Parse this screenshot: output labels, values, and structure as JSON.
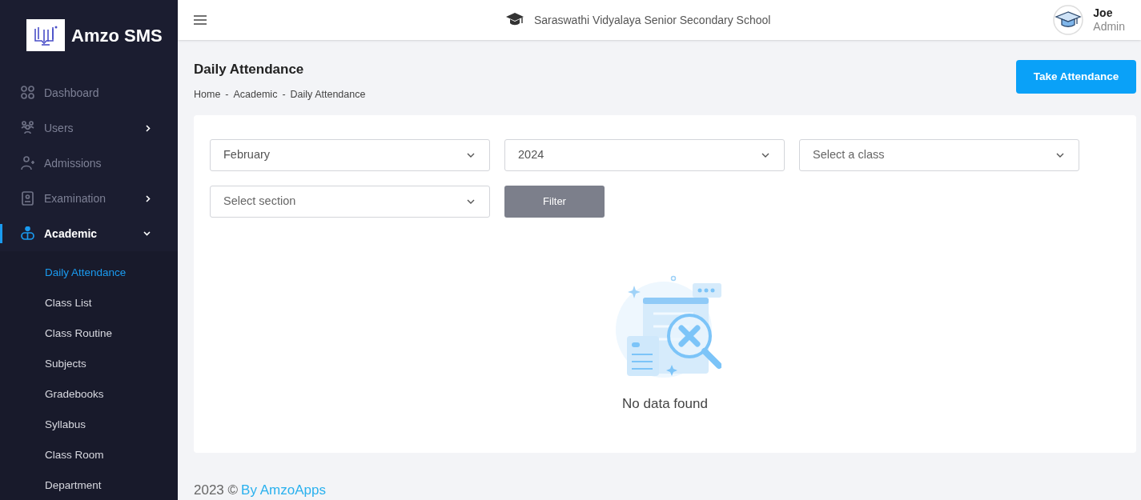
{
  "brand": {
    "name": "Amzo SMS"
  },
  "sidebar": {
    "items": [
      {
        "label": "Dashboard",
        "selected": false
      },
      {
        "label": "Users",
        "selected": false,
        "expanded": false
      },
      {
        "label": "Admissions",
        "selected": false
      },
      {
        "label": "Examination",
        "selected": false,
        "expanded": false
      },
      {
        "label": "Academic",
        "selected": true,
        "expanded": true,
        "children": [
          {
            "label": "Daily Attendance",
            "selected": true
          },
          {
            "label": "Class List",
            "selected": false
          },
          {
            "label": "Class Routine",
            "selected": false
          },
          {
            "label": "Subjects",
            "selected": false
          },
          {
            "label": "Gradebooks",
            "selected": false
          },
          {
            "label": "Syllabus",
            "selected": false
          },
          {
            "label": "Class Room",
            "selected": false
          },
          {
            "label": "Department",
            "selected": false
          }
        ]
      }
    ]
  },
  "header": {
    "school": "Saraswathi Vidyalaya Senior Secondary School",
    "user": {
      "name": "Joe",
      "role": "Admin"
    }
  },
  "page": {
    "title": "Daily Attendance",
    "breadcrumb": [
      "Home",
      "Academic",
      "Daily Attendance"
    ],
    "breadcrumb_separator": "-",
    "action": "Take Attendance"
  },
  "filters": [
    {
      "value": "February"
    },
    {
      "value": "2024"
    },
    {
      "placeholder": "Select a class"
    },
    {
      "placeholder": "Select section"
    }
  ],
  "filter_button": "Filter",
  "empty_message": "No data found",
  "footer": {
    "year": "2023 ©",
    "link": "By AmzoApps"
  }
}
